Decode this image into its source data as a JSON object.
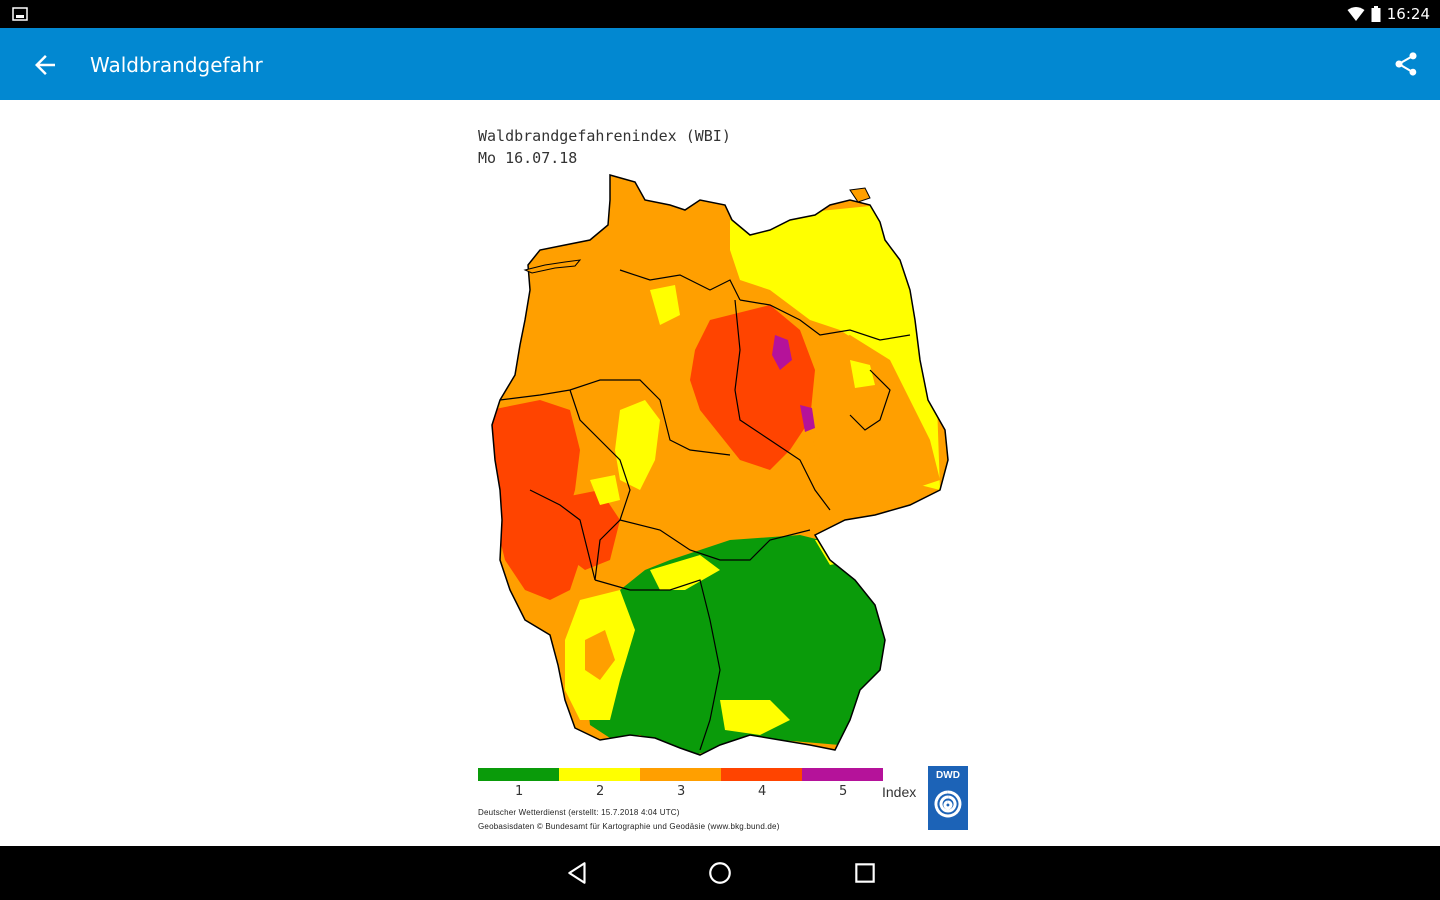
{
  "status_bar": {
    "time": "16:24"
  },
  "app_bar": {
    "title": "Waldbrandgefahr"
  },
  "map": {
    "title_line1": "Waldbrandgefahrenindex (WBI)",
    "title_line2": "Mo 16.07.18"
  },
  "legend": {
    "levels": [
      {
        "label": "1",
        "color": "#0a9b0a"
      },
      {
        "label": "2",
        "color": "#ffff00"
      },
      {
        "label": "3",
        "color": "#ff9f00"
      },
      {
        "label": "4",
        "color": "#ff4400"
      },
      {
        "label": "5",
        "color": "#b5129a"
      }
    ],
    "index_label": "Index",
    "credit_line1": "Deutscher Wetterdienst (erstellt: 15.7.2018 4:04 UTC)",
    "credit_line2": "Geobasisdaten © Bundesamt für Kartographie und Geodäsie (www.bkg.bund.de)",
    "logo_text": "DWD"
  },
  "colors": {
    "app_bar": "#0288d1",
    "level1": "#0a9b0a",
    "level2": "#ffff00",
    "level3": "#ff9f00",
    "level4": "#ff4400",
    "level5": "#b5129a"
  }
}
